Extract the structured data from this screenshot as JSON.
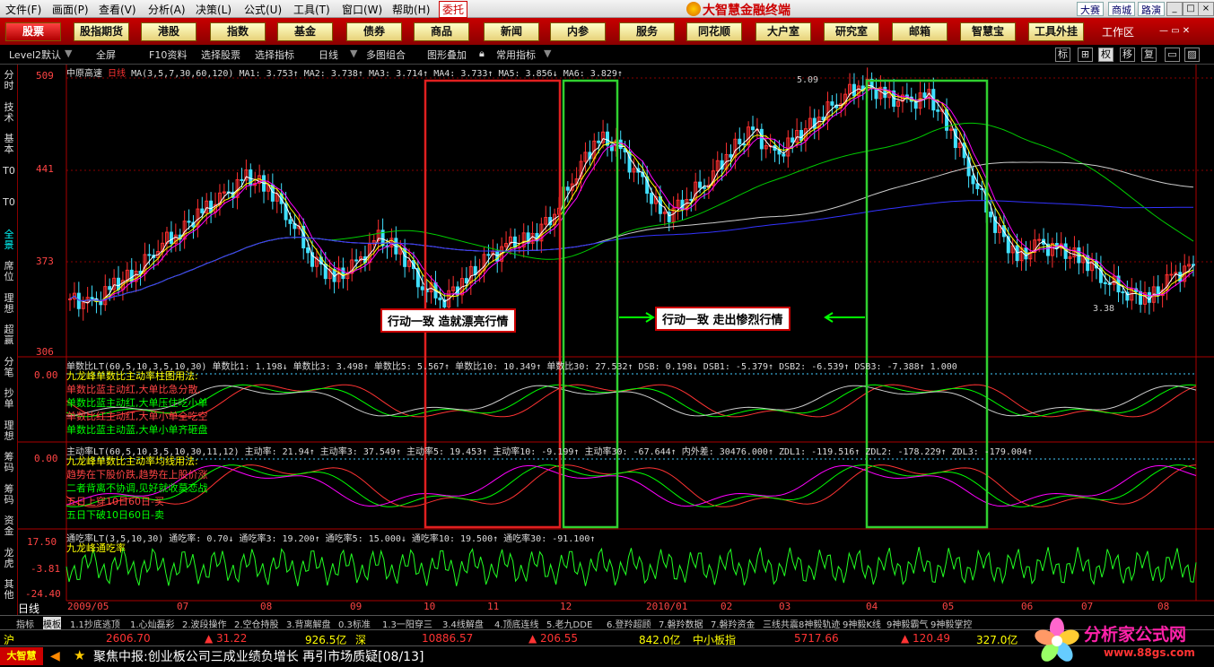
{
  "menubar": {
    "items": [
      "文件(F)",
      "画面(P)",
      "查看(V)",
      "分析(A)",
      "决策(L)",
      "公式(U)",
      "工具(T)",
      "窗口(W)",
      "帮助(H)"
    ],
    "entrust": "委托",
    "app_title": "大智慧金融终端",
    "links": [
      "大赛",
      "商城",
      "路演"
    ]
  },
  "tabs": [
    "股票",
    "股指期货",
    "港股",
    "指数",
    "基金",
    "债券",
    "商品",
    "新闻",
    "内参",
    "服务",
    "同花顺",
    "大户室",
    "研究室",
    "邮箱",
    "智慧宝",
    "工具外挂"
  ],
  "workroom": "工作区",
  "toolbar": {
    "level2": "Level2默认",
    "fullscreen": "全屏",
    "f10": "F10资料",
    "select_stock": "选择股票",
    "select_indicator": "选择指标",
    "period": "日线",
    "multi": "多图组合",
    "overlay": "图形叠加",
    "common": "常用指标",
    "right_icons": [
      "标",
      "⊞",
      "权",
      "移",
      "复",
      "▭",
      "▨"
    ]
  },
  "sidebar": [
    "分时",
    "技术",
    "基本",
    "T0",
    "T0",
    "全景",
    "席位",
    "理想",
    "超赢",
    "分笔",
    "抄单",
    "理想",
    "筹码",
    "筹码",
    "资金",
    "龙虎",
    "其他"
  ],
  "chart_data": {
    "type": "candlestick",
    "stock_name": "中原高速",
    "period": "日线",
    "ma_text": "MA(3,5,7,30,60,120) MA1: 3.753↑ MA2: 3.738↑ MA3: 3.714↑ MA4: 3.733↑ MA5: 3.856↓ MA6: 3.829↑",
    "y_ticks": [
      "509",
      "441",
      "373",
      "306"
    ],
    "high_label": "5.09",
    "low_label": "3.38",
    "x_labels": [
      "2009/05",
      "07",
      "08",
      "09",
      "10",
      "11",
      "12",
      "2010/01",
      "02",
      "03",
      "04",
      "05",
      "06",
      "07",
      "08"
    ],
    "close_series": [
      3.45,
      3.4,
      3.55,
      3.65,
      3.85,
      3.95,
      4.1,
      4.2,
      4.35,
      4.28,
      4.05,
      3.75,
      3.6,
      3.7,
      3.9,
      3.8,
      3.55,
      3.45,
      3.6,
      3.75,
      3.85,
      3.9,
      4.1,
      4.4,
      4.65,
      4.55,
      4.3,
      4.05,
      4.2,
      4.35,
      4.55,
      4.7,
      4.5,
      4.65,
      4.8,
      4.95,
      5.05,
      4.95,
      4.9,
      4.95,
      4.7,
      4.35,
      4.0,
      3.75,
      3.85,
      3.8,
      3.75,
      3.6,
      3.5,
      3.45,
      3.6,
      3.7
    ]
  },
  "annotations": {
    "left": "行动一致 造就漂亮行情",
    "right": "行动一致 走出惨烈行情"
  },
  "pane2": {
    "axis": "0.00",
    "header": "单数比LT(60,5,10,3,5,10,30) 单数比1: 1.198↓ 单数比3: 3.498↑ 单数比5: 5.567↑ 单数比10: 10.349↑ 单数比30: 27.532↑ DSB: 0.198↓ DSB1: -5.379↑ DSB2: -6.539↑ DSB3: -7.388↑ 1.000",
    "notes": [
      "九龙峰单数比主动率柱图用法:",
      "单数比蓝主动红,大单比急分散,",
      "单数比蓝主动红,大单压住吃小单",
      "单数比红主动红,大单小单全吃空",
      "单数比蓝主动蓝,大单小单齐砸盘"
    ]
  },
  "pane3": {
    "axis": "0.00",
    "header": "主动率LT(60,5,10,3,5,10,30,11,12) 主动率: 21.94↑ 主动率3: 37.549↑ 主动率5: 19.453↑ 主动率10: -9.199↑ 主动率30: -67.644↑ 内外差: 30476.000↑ ZDL1: -119.516↑ ZDL2: -178.229↑ ZDL3: -179.004↑",
    "notes": [
      "九龙峰单数比主动率均线用法:",
      "趋势在下股价跌,趋势在上股价涨",
      "二者背离不协调,见好就收莫恋战",
      "五日上穿10日60日-买",
      "五日下破10日60日-卖"
    ]
  },
  "pane4": {
    "axis": [
      "17.50",
      "-3.81",
      "-24.40"
    ],
    "header": "通吃率LT(3,5,10,30) 通吃率: 0.70↓ 通吃率3: 19.200↑ 通吃率5: 15.000↓ 通吃率10: 19.500↑ 通吃率30: -91.100↑",
    "note": "九龙峰通吃率"
  },
  "period_label": "日线",
  "indicator_tabs": [
    "指标",
    "模板",
    "1.1抄底逃顶",
    "1.心灿磊彩",
    "2.波段操作",
    "2.空仓持股",
    "3.背离解盘",
    "0.3标准",
    "1.3一阳穿三",
    "3.4线解盘",
    "4.顶底连线",
    "5.老九DDE",
    "6.登羚超顾",
    "7.磐羚数据",
    "7.磐羚资金",
    "三线共震",
    "8神毅轨迹",
    "9神毅K线",
    "9神毅霸气",
    "9神毅掌控"
  ],
  "quotes": {
    "sh_label": "沪",
    "sh_index": "2606.70",
    "sh_change": "▲ 31.22",
    "sh_amount": "926.5亿",
    "sz_label": "深",
    "sz_index": "10886.57",
    "sz_change": "▲ 206.55",
    "sz_amount": "842.0亿",
    "sme_label": "中小板指",
    "sme_index": "5717.66",
    "sme_change": "▲ 120.49",
    "sme_amount": "327.0亿"
  },
  "news": {
    "brand": "大智慧",
    "text": "聚焦中报:创业板公司三成业绩负增长 再引市场质疑[08/13]"
  },
  "watermark": {
    "title": "分析家公式网",
    "url": "www.88gs.com"
  },
  "colors": {
    "menu_red": "#c70000",
    "up": "#ff3030",
    "down": "#40e0ff",
    "red_box": "#e02020",
    "green_box": "#30d030"
  }
}
